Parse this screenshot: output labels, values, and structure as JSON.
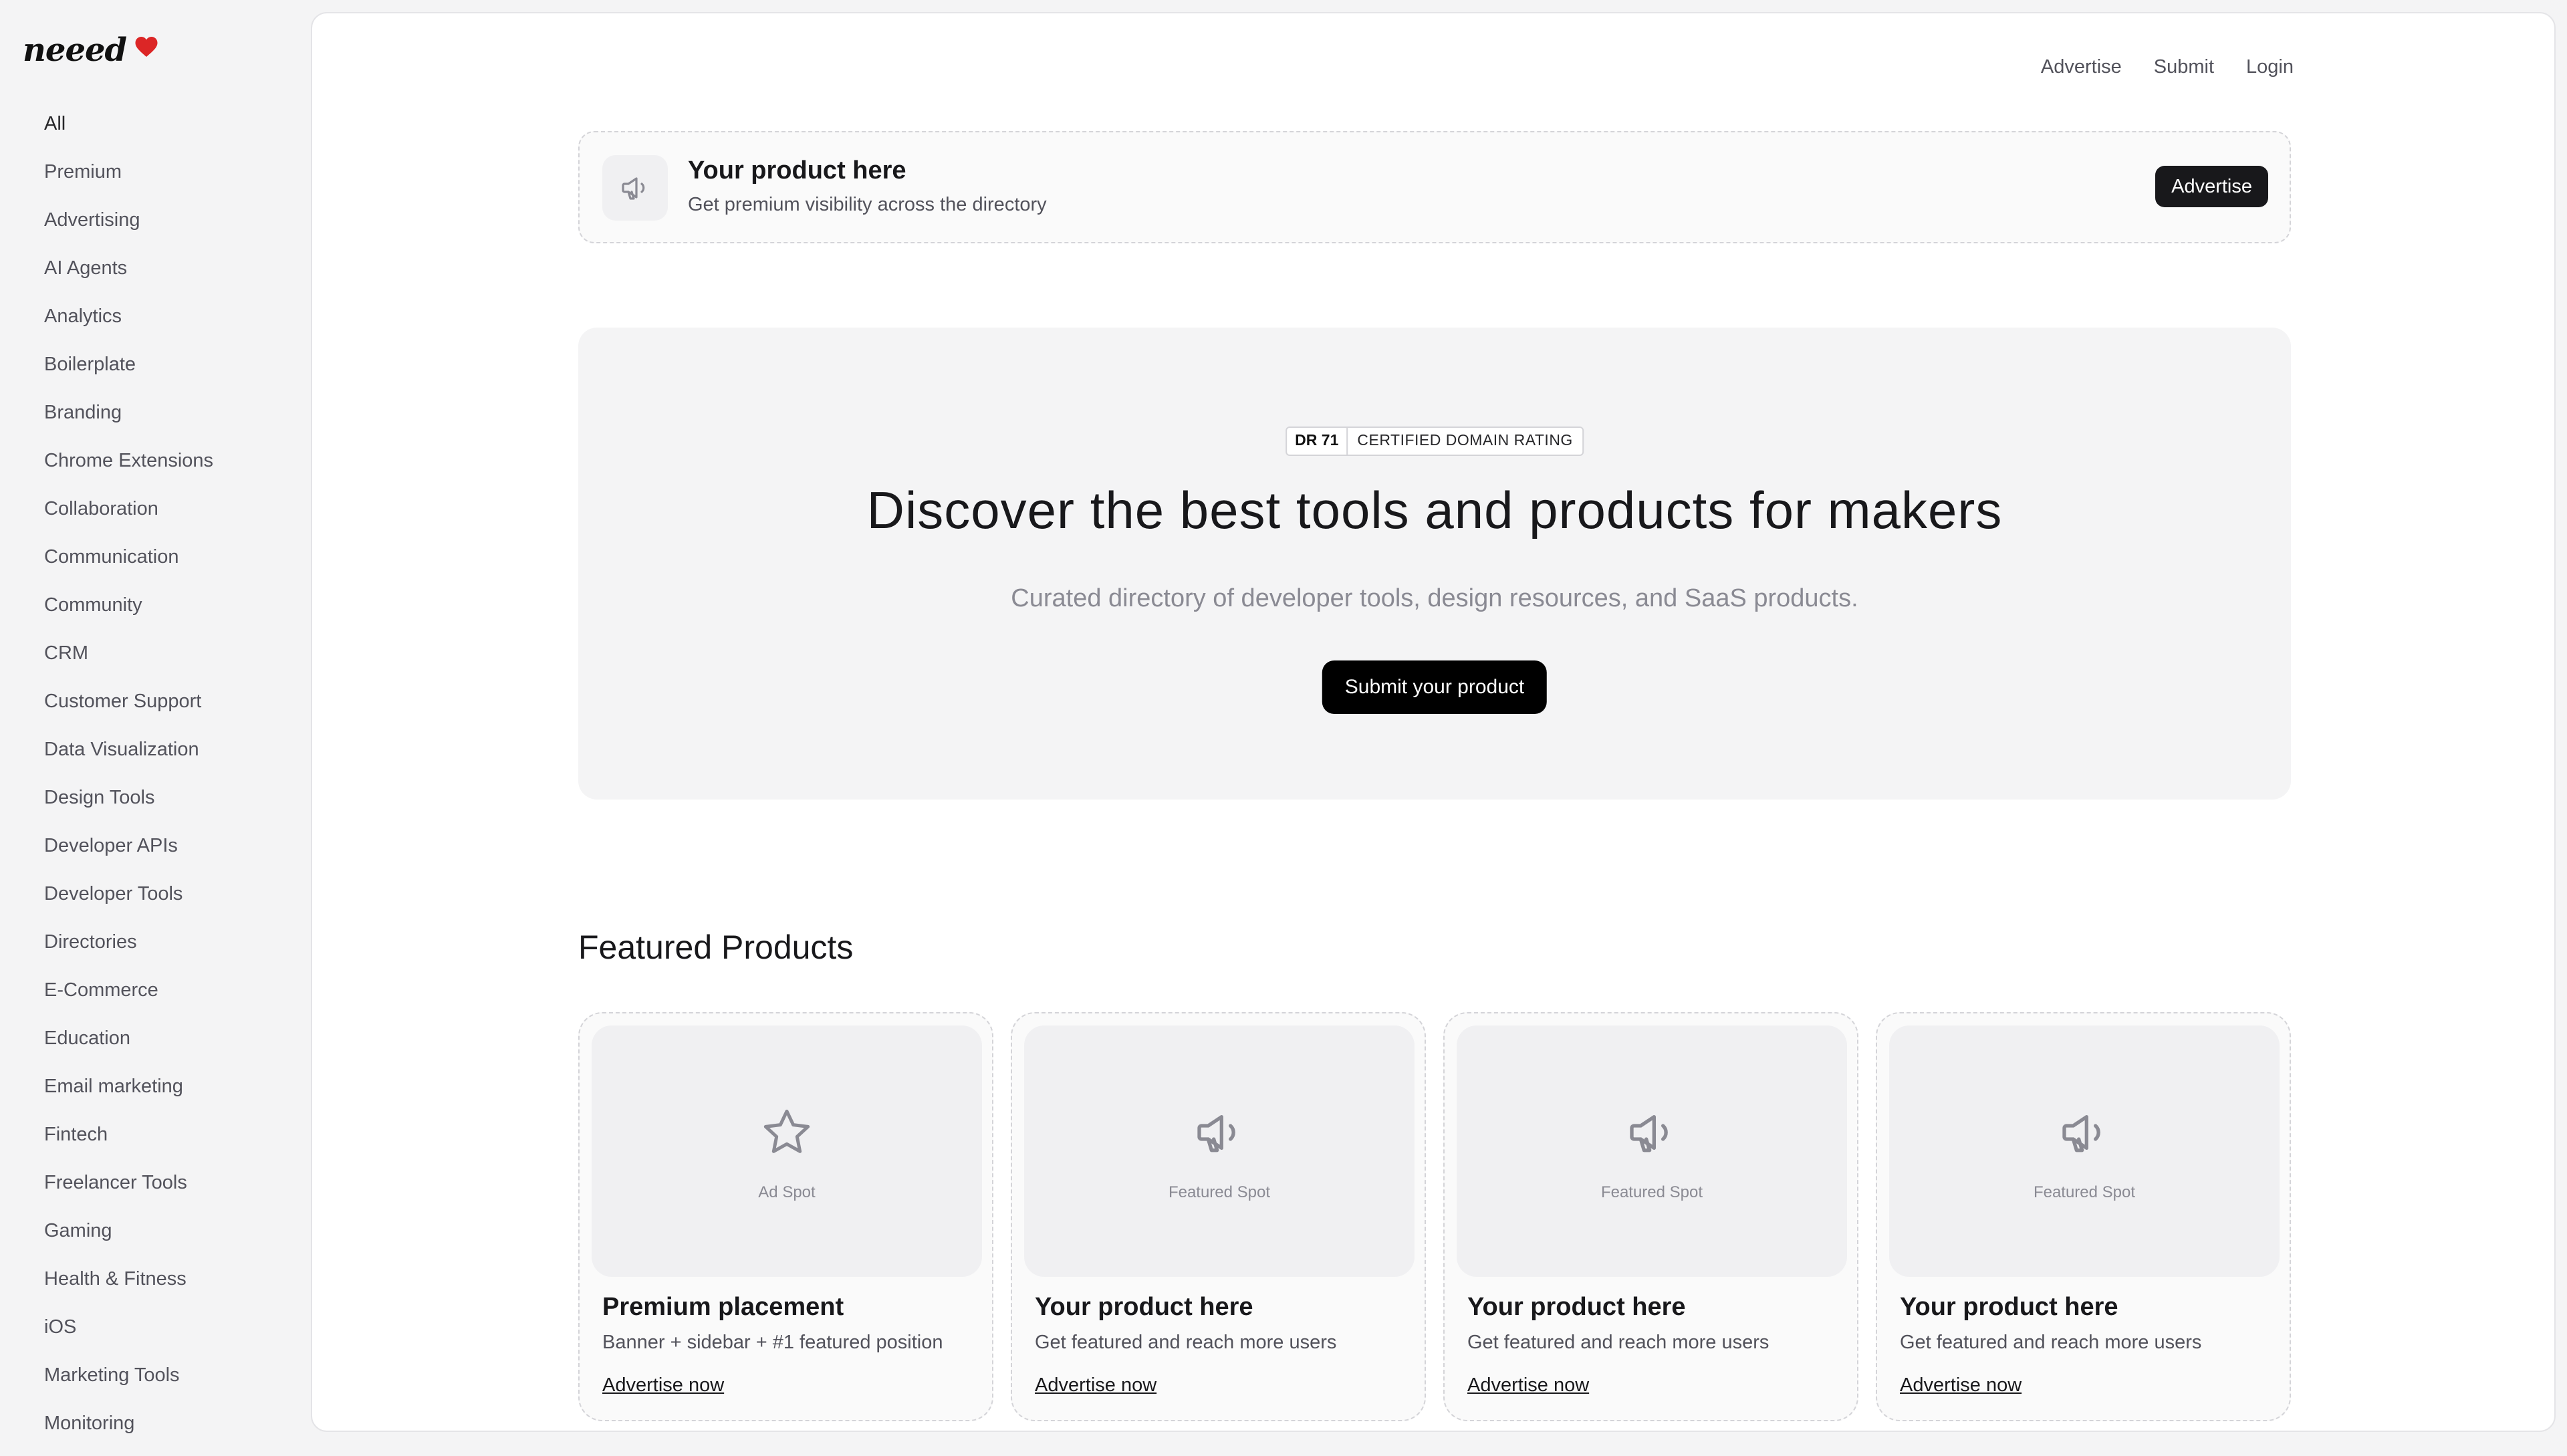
{
  "brand": {
    "name": "neeed",
    "accent": "#dc2626"
  },
  "sidebar": {
    "items": [
      "All",
      "Premium",
      "Advertising",
      "AI Agents",
      "Analytics",
      "Boilerplate",
      "Branding",
      "Chrome Extensions",
      "Collaboration",
      "Communication",
      "Community",
      "CRM",
      "Customer Support",
      "Data Visualization",
      "Design Tools",
      "Developer APIs",
      "Developer Tools",
      "Directories",
      "E-Commerce",
      "Education",
      "Email marketing",
      "Fintech",
      "Freelancer Tools",
      "Gaming",
      "Health & Fitness",
      "iOS",
      "Marketing Tools",
      "Monitoring"
    ]
  },
  "topnav": {
    "advertise": "Advertise",
    "submit": "Submit",
    "login": "Login"
  },
  "banner": {
    "icon": "megaphone-icon",
    "title": "Your product here",
    "subtitle": "Get premium visibility across the directory",
    "button": "Advertise"
  },
  "hero": {
    "badge_dr": "DR 71",
    "badge_text": "CERTIFIED DOMAIN RATING",
    "title": "Discover the best tools and products for makers",
    "subtitle": "Curated directory of developer tools, design resources, and SaaS products.",
    "button": "Submit your product"
  },
  "featured": {
    "heading": "Featured Products",
    "cards": [
      {
        "icon": "star-icon",
        "caption": "Ad Spot",
        "title": "Premium placement",
        "desc": "Banner + sidebar + #1 featured position",
        "link": "Advertise now"
      },
      {
        "icon": "megaphone-icon",
        "caption": "Featured Spot",
        "title": "Your product here",
        "desc": "Get featured and reach more users",
        "link": "Advertise now"
      },
      {
        "icon": "megaphone-icon",
        "caption": "Featured Spot",
        "title": "Your product here",
        "desc": "Get featured and reach more users",
        "link": "Advertise now"
      },
      {
        "icon": "megaphone-icon",
        "caption": "Featured Spot",
        "title": "Your product here",
        "desc": "Get featured and reach more users",
        "link": "Advertise now"
      }
    ]
  }
}
